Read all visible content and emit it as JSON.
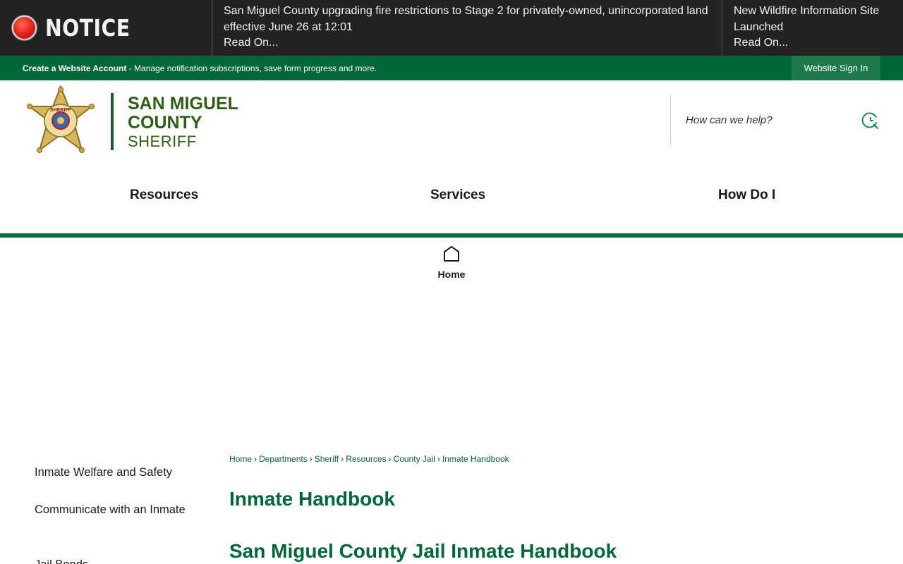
{
  "notice": {
    "label": "NOTICE",
    "items": [
      {
        "text": "San Miguel County upgrading fire restrictions to Stage 2 for privately-owned, unincorporated land effective June 26 at 12:01",
        "link": "Read On..."
      },
      {
        "text": "New Wildfire Information Site Launched",
        "link": "Read On..."
      }
    ]
  },
  "account_bar": {
    "create_link": "Create a Website Account",
    "description": " - Manage notification subscriptions, save form progress and more.",
    "sign_in": "Website Sign In"
  },
  "brand": {
    "line1": "SAN MIGUEL",
    "line2": "COUNTY",
    "line3": "SHERIFF",
    "badge_text": "SHERIFF",
    "colors": {
      "primary": "#006838",
      "brand_text": "#2e5f14"
    }
  },
  "search": {
    "placeholder": "How can we help?",
    "icon": "search-icon"
  },
  "nav": {
    "resources": "Resources",
    "services": "Services",
    "how_do_i": "How Do I"
  },
  "home": {
    "label": "Home",
    "icon": "home-icon"
  },
  "sidebar": {
    "items": [
      {
        "label": "Inmate Welfare and Safety"
      },
      {
        "label": "Communicate with an Inmate"
      },
      {
        "label": "Jail Bonds"
      }
    ]
  },
  "breadcrumb": [
    "Home",
    "Departments",
    "Sheriff",
    "Resources",
    "County Jail",
    "Inmate Handbook"
  ],
  "page": {
    "title": "Inmate Handbook",
    "subtitle": "San Miguel County Jail Inmate Handbook"
  }
}
